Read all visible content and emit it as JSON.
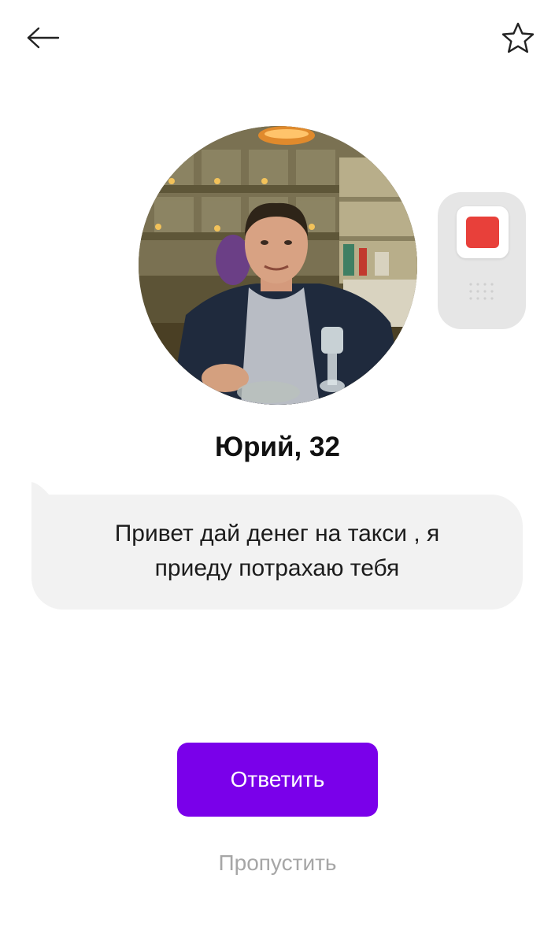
{
  "header": {
    "back_icon": "arrow-left-icon",
    "favorite_icon": "star-outline-icon"
  },
  "profile": {
    "name_age": "Юрий, 32",
    "photo": "profile-photo"
  },
  "stop_widget": {
    "icon": "stop-square-icon",
    "accent_color": "#e8403a"
  },
  "message": {
    "line1": "Привет дай денег на такси , я",
    "line2": "приеду потрахаю тебя"
  },
  "actions": {
    "reply_label": "Ответить",
    "skip_label": "Пропустить",
    "reply_color": "#7a00ea"
  }
}
